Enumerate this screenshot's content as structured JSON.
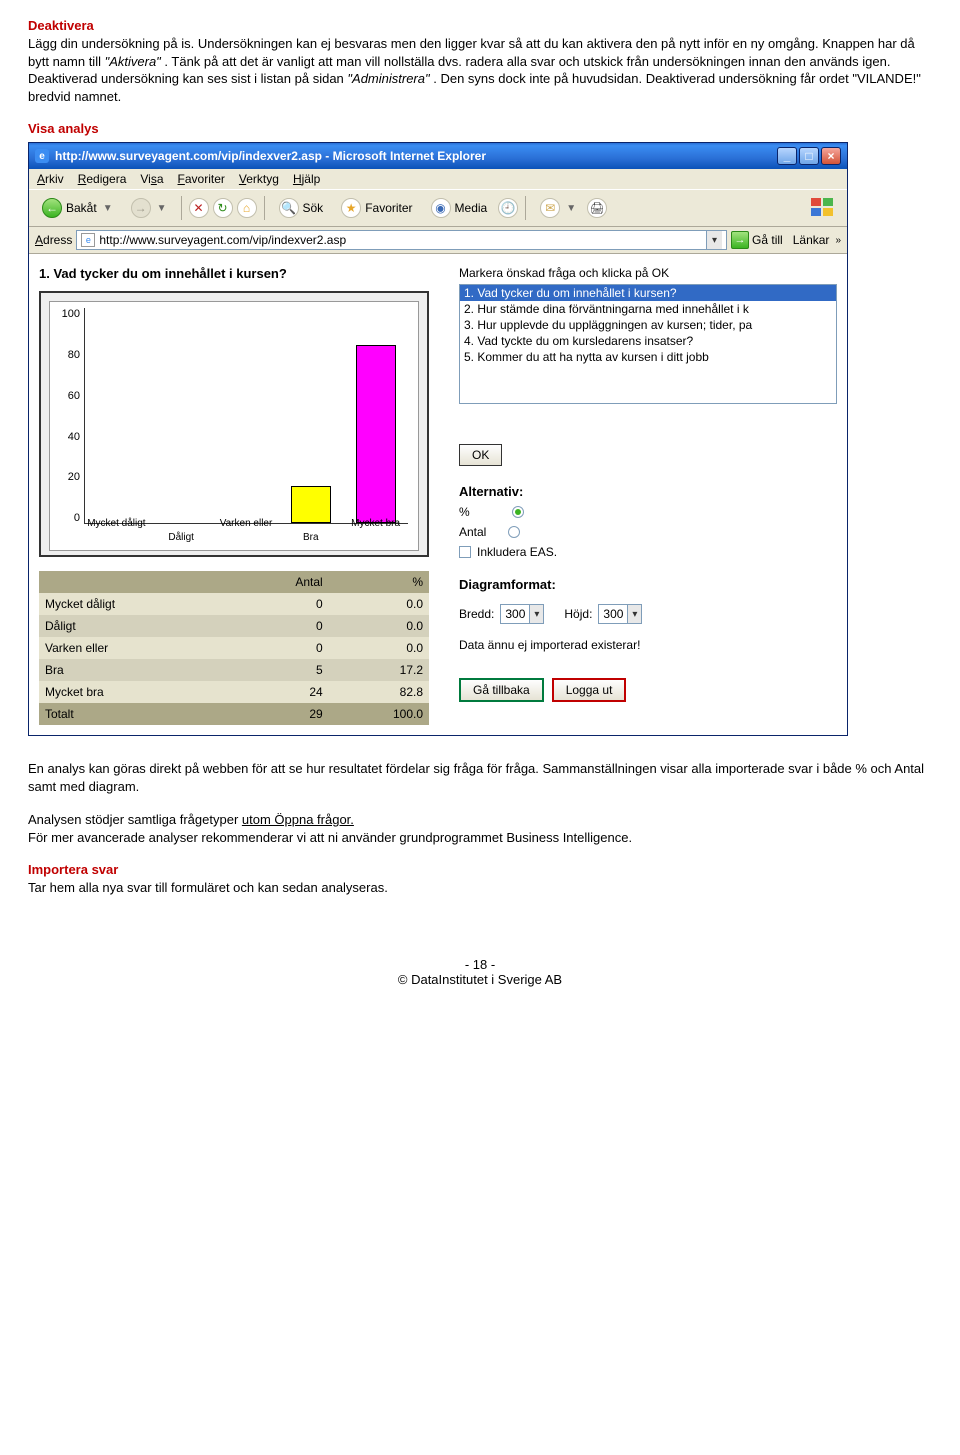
{
  "sections": {
    "deaktivera": {
      "title": "Deaktivera",
      "p1": "Lägg din undersökning på is. Undersökningen kan ej besvaras men den ligger kvar så att du kan aktivera den på nytt inför en ny omgång. Knappen har då bytt namn till ",
      "p1_italic": "\"Aktivera\"",
      "p1_end": ". Tänk på att det är vanligt att man vill nollställa dvs. radera alla svar och utskick från undersökningen innan den används igen. Deaktiverad undersökning kan ses sist i listan på sidan ",
      "p1_italic2": "\"Administrera\"",
      "p1_end2": ". Den syns dock inte på huvudsidan. Deaktiverad undersökning får ordet \"VILANDE!\" bredvid namnet."
    },
    "visa_analys": {
      "title": "Visa analys"
    },
    "below": {
      "p1": "En analys kan göras direkt på webben för att se hur resultatet fördelar sig fråga för fråga. Sammanställningen visar alla importerade svar i både % och Antal samt med diagram.",
      "p2a": "Analysen stödjer samtliga frågetyper ",
      "p2_u": "utom Öppna frågor.",
      "p3": "För mer avancerade analyser rekommenderar vi att ni använder grundprogrammet Business Intelligence."
    },
    "importera": {
      "title": "Importera svar",
      "p": "Tar hem alla nya svar till formuläret och kan sedan analyseras."
    }
  },
  "browser": {
    "title": "http://www.surveyagent.com/vip/indexver2.asp - Microsoft Internet Explorer",
    "menu": [
      "Arkiv",
      "Redigera",
      "Visa",
      "Favoriter",
      "Verktyg",
      "Hjälp"
    ],
    "toolbar": {
      "back": "Bakåt",
      "search": "Sök",
      "favorites": "Favoriter",
      "media": "Media"
    },
    "address_label": "Adress",
    "address_url": "http://www.surveyagent.com/vip/indexver2.asp",
    "go": "Gå till",
    "links": "Länkar"
  },
  "page": {
    "question_title": "1. Vad tycker du om innehållet i kursen?",
    "right_instr": "Markera önskad fråga och klicka på OK",
    "questions": [
      "1. Vad tycker du om innehållet i kursen?",
      "2. Hur stämde dina förväntningarna med innehållet i k",
      "3. Hur upplevde du uppläggningen av kursen; tider, pa",
      "4. Vad tyckte du om kursledarens insatser?",
      "5. Kommer du att ha nytta av kursen i ditt jobb"
    ],
    "ok": "OK",
    "alt_title": "Alternativ:",
    "opt_percent": "%",
    "opt_antal": "Antal",
    "opt_eas": "Inkludera EAS.",
    "diagram": "Diagramformat:",
    "bredd": "Bredd:",
    "hojd": "Höjd:",
    "width_val": "300",
    "height_val": "300",
    "import_msg": "Data ännu ej importerad existerar!",
    "back": "Gå tillbaka",
    "logout": "Logga ut",
    "table": {
      "headers": [
        "",
        "Antal",
        "%"
      ],
      "rows": [
        [
          "Mycket dåligt",
          "0",
          "0.0"
        ],
        [
          "Dåligt",
          "0",
          "0.0"
        ],
        [
          "Varken eller",
          "0",
          "0.0"
        ],
        [
          "Bra",
          "5",
          "17.2"
        ],
        [
          "Mycket bra",
          "24",
          "82.8"
        ]
      ],
      "total": [
        "Totalt",
        "29",
        "100.0"
      ]
    }
  },
  "chart_data": {
    "type": "bar",
    "categories": [
      "Mycket dåligt",
      "Dåligt",
      "Varken eller",
      "Bra",
      "Mycket bra"
    ],
    "values": [
      0,
      0,
      0,
      17.2,
      82.8
    ],
    "colors": [
      "#ff00ff",
      "#ffff00",
      "#ffff00",
      "#ffff00",
      "#ff00ff"
    ],
    "ylim": [
      0,
      100
    ],
    "yticks": [
      0,
      20,
      40,
      60,
      80,
      100
    ]
  },
  "footer": {
    "page": "- 18 -",
    "copy": "© DataInstitutet i Sverige AB"
  }
}
